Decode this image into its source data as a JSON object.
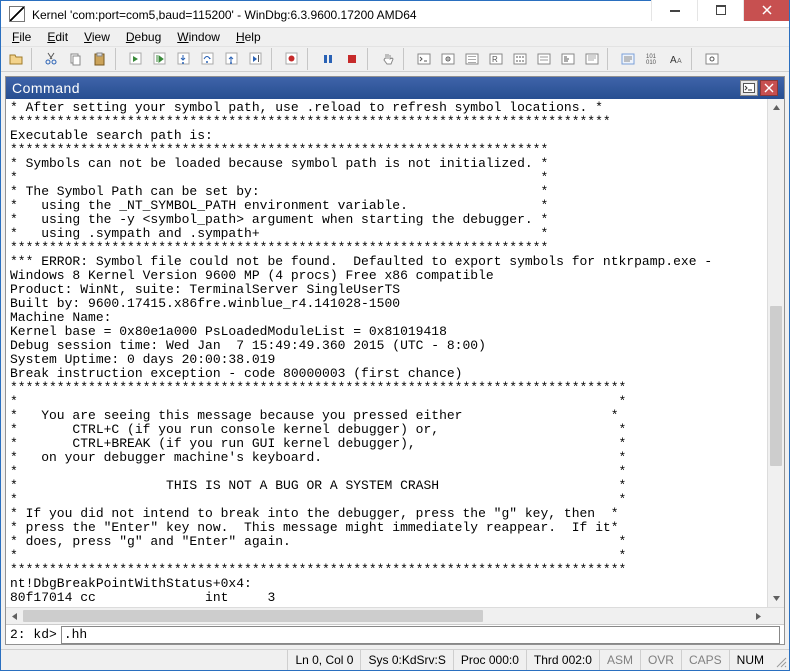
{
  "window": {
    "title": "Kernel 'com:port=com5,baud=115200' - WinDbg:6.3.9600.17200 AMD64"
  },
  "menu": {
    "file": "File",
    "edit": "Edit",
    "view": "View",
    "debug": "Debug",
    "window": "Window",
    "help": "Help"
  },
  "pane": {
    "title": "Command"
  },
  "prompt": {
    "label": "2: kd>",
    "value": ".hh"
  },
  "status": {
    "lncol": "Ln 0, Col 0",
    "sys": "Sys 0:KdSrv:S",
    "proc": "Proc 000:0",
    "thrd": "Thrd 002:0",
    "asm": "ASM",
    "ovr": "OVR",
    "caps": "CAPS",
    "num": "NUM"
  },
  "output": "* After setting your symbol path, use .reload to refresh symbol locations. *\n*****************************************************************************\nExecutable search path is:\n*********************************************************************\n* Symbols can not be loaded because symbol path is not initialized. *\n*                                                                   *\n* The Symbol Path can be set by:                                    *\n*   using the _NT_SYMBOL_PATH environment variable.                 *\n*   using the -y <symbol_path> argument when starting the debugger. *\n*   using .sympath and .sympath+                                    *\n*********************************************************************\n*** ERROR: Symbol file could not be found.  Defaulted to export symbols for ntkrpamp.exe -\nWindows 8 Kernel Version 9600 MP (4 procs) Free x86 compatible\nProduct: WinNt, suite: TerminalServer SingleUserTS\nBuilt by: 9600.17415.x86fre.winblue_r4.141028-1500\nMachine Name:\nKernel base = 0x80e1a000 PsLoadedModuleList = 0x81019418\nDebug session time: Wed Jan  7 15:49:49.360 2015 (UTC - 8:00)\nSystem Uptime: 0 days 20:00:38.019\nBreak instruction exception - code 80000003 (first chance)\n*******************************************************************************\n*                                                                             *\n*   You are seeing this message because you pressed either                   *\n*       CTRL+C (if you run console kernel debugger) or,                       *\n*       CTRL+BREAK (if you run GUI kernel debugger),                          *\n*   on your debugger machine's keyboard.                                      *\n*                                                                             *\n*                   THIS IS NOT A BUG OR A SYSTEM CRASH                       *\n*                                                                             *\n* If you did not intend to break into the debugger, press the \"g\" key, then  *\n* press the \"Enter\" key now.  This message might immediately reappear.  If it*\n* does, press \"g\" and \"Enter\" again.                                          *\n*                                                                             *\n*******************************************************************************\nnt!DbgBreakPointWithStatus+0x4:\n80f17014 cc              int     3"
}
